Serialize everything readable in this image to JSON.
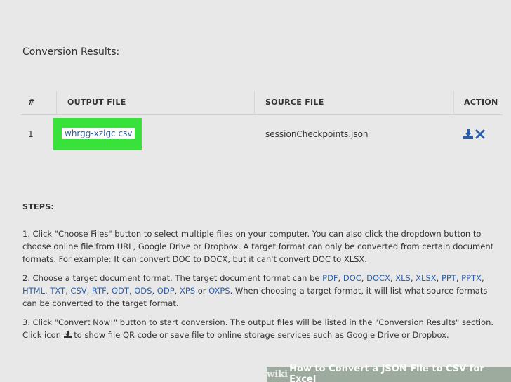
{
  "results": {
    "title": "Conversion Results:",
    "headers": {
      "num": "#",
      "output": "OUTPUT FILE",
      "source": "SOURCE FILE",
      "action": "ACTION"
    },
    "rows": [
      {
        "num": "1",
        "output": "whrgg-xzlgc.csv",
        "source": "sessionCheckpoints.json"
      }
    ]
  },
  "colors": {
    "link": "#2a5ea8",
    "highlight": "#39e23a",
    "background": "#e8e8e8"
  },
  "icons": {
    "download": "download-icon",
    "delete": "close-icon"
  },
  "steps": {
    "title": "STEPS:",
    "step1": "1. Click \"Choose Files\" button to select multiple files on your computer. You can also click the dropdown button to choose online file from URL, Google Drive or Dropbox. A target format can only be converted from certain document formats. For example: It can convert DOC to DOCX, but it can't convert DOC to XLSX.",
    "step2_prefix": "2. Choose a target document format. The target document format can be",
    "formats": [
      "PDF",
      "DOC",
      "DOCX",
      "XLS",
      "XLSX",
      "PPT",
      "PPTX",
      "HTML",
      "TXT",
      "CSV",
      "RTF",
      "ODT",
      "ODS",
      "ODP",
      "XPS",
      "OXPS"
    ],
    "step2_suffix": ". When choosing a target format, it will list what source formats can be converted to the target format.",
    "step3_part1": "3. Click \"Convert Now!\" button to start conversion. The output files will be listed in the \"Conversion Results\" section. Click icon",
    "step3_part2": "to show file QR code or save file to online storage services such as Google Drive or Dropbox."
  },
  "banner": {
    "wiki": "wiki",
    "how": "How to Convert a JSON File to CSV for Excel"
  }
}
